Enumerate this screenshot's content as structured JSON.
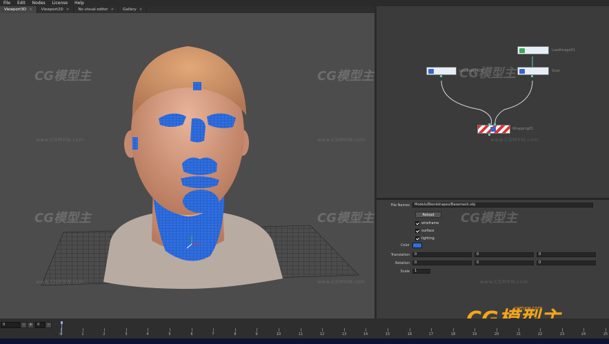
{
  "menu": [
    "File",
    "Edit",
    "Nodes",
    "License",
    "Help"
  ],
  "tabs": [
    {
      "label": "Viewport3D",
      "active": true
    },
    {
      "label": "Viewport2D",
      "active": false
    },
    {
      "label": "No visual editor",
      "active": false
    },
    {
      "label": "Gallery",
      "active": false
    }
  ],
  "tab_close": "×",
  "nodes": {
    "loadimage": "LoadImage01",
    "left": "LoadImage02",
    "scan": "Scan",
    "wrapping": "Wrapping01"
  },
  "properties": {
    "file_names_label": "File Names",
    "file_names_value": "Models/Blendshapes/Basemesh.obj",
    "reload_label": "Reload",
    "wireframe_label": "wireframe",
    "surface_label": "surface",
    "lighting_label": "lighting",
    "color_label": "Color",
    "color_value": "#2f6fe0",
    "translation_label": "Translation",
    "translation": [
      "0",
      "0",
      "0"
    ],
    "rotation_label": "Rotation",
    "rotation": [
      "0",
      "0",
      "0"
    ],
    "scale_label": "Scale",
    "scale": "1"
  },
  "timeline": {
    "start": "0",
    "current": "0",
    "ticks": [
      "0",
      "1",
      "2",
      "3",
      "4",
      "5",
      "6",
      "7",
      "8",
      "9",
      "10",
      "11",
      "12",
      "13",
      "14",
      "15",
      "16",
      "17",
      "18",
      "19",
      "20",
      "21",
      "22",
      "23",
      "24",
      "25"
    ]
  },
  "watermarks": {
    "brand": "CG模型主",
    "url": "www.CGMXW.com",
    "logo_url": "cgmxw.com"
  },
  "colors": {
    "mesh_blue": "#2f6fe0",
    "brand_orange": "#f4a51a"
  }
}
